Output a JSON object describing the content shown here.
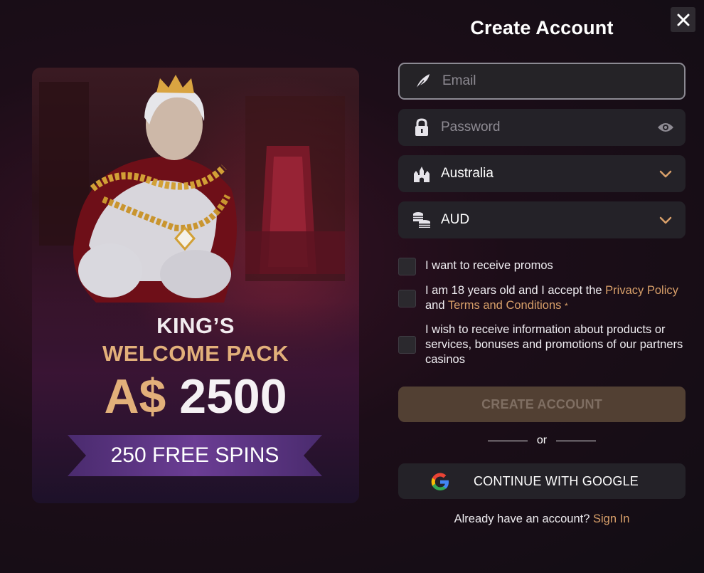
{
  "dialog": {
    "title": "Create Account",
    "close_icon": "close-icon"
  },
  "promo": {
    "line1": "KING’S",
    "line2": "WELCOME PACK",
    "currency": "A$",
    "amount": "2500",
    "spins": "250 FREE SPINS"
  },
  "form": {
    "email": {
      "placeholder": "Email",
      "value": "",
      "icon": "feather-icon"
    },
    "password": {
      "placeholder": "Password",
      "value": "",
      "icon": "lock-icon",
      "toggle_icon": "eye-icon"
    },
    "country": {
      "value": "Australia",
      "icon": "castle-icon",
      "chevron": "chevron-down-icon"
    },
    "currency": {
      "value": "AUD",
      "icon": "coins-icon",
      "chevron": "chevron-down-icon"
    }
  },
  "checkboxes": {
    "promos": {
      "label": "I want to receive promos",
      "checked": false
    },
    "terms": {
      "prefix": "I am 18 years old and I accept the",
      "privacy_link": "Privacy Policy",
      "and": "and",
      "terms_link": "Terms and Conditions",
      "required_mark": "*",
      "checked": false
    },
    "partners": {
      "label": "I wish to receive information about products or services, bonuses and promotions of our partners casinos",
      "checked": false
    }
  },
  "actions": {
    "create_label": "CREATE ACCOUNT",
    "or_label": "or",
    "google_label": "CONTINUE WITH GOOGLE",
    "google_icon": "google-icon",
    "signin_prompt": "Already have an account?",
    "signin_link": "Sign In"
  },
  "colors": {
    "accent": "#d9a06a",
    "field_bg": "#242228",
    "create_disabled_bg": "#524033"
  }
}
